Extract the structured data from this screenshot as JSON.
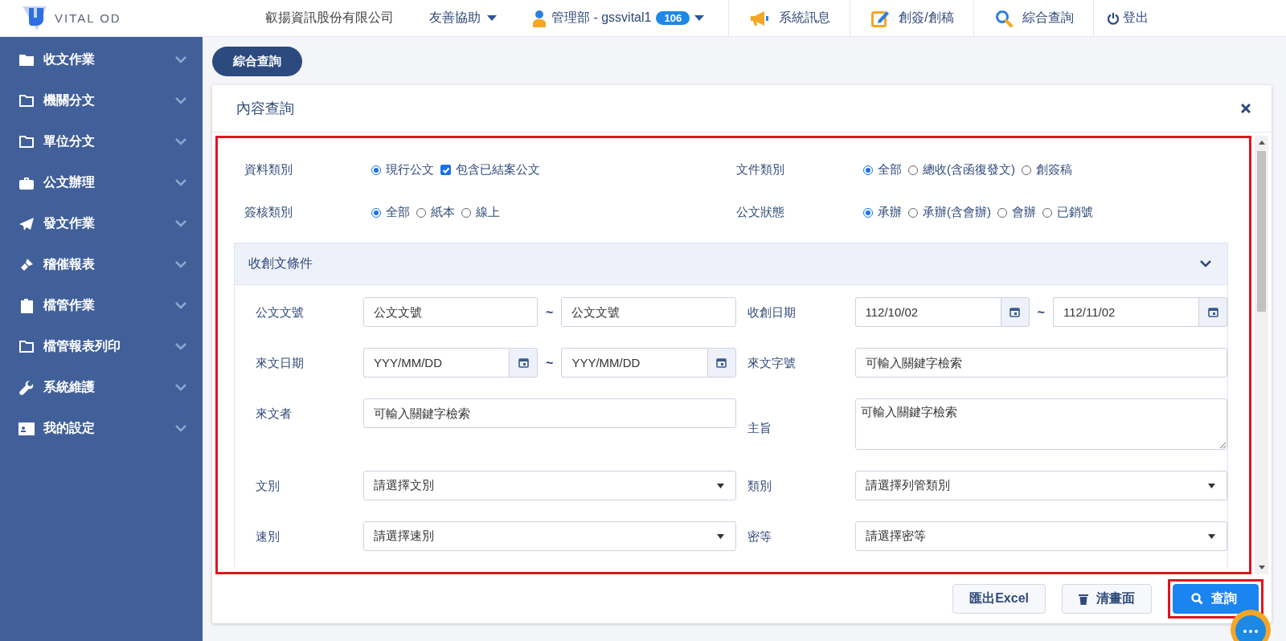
{
  "header": {
    "logo_text": "VITAL OD",
    "company": "叡揚資訊股份有限公司",
    "help": "友善協助",
    "user": "管理部 - gssvital1",
    "badge": "106",
    "nav": [
      {
        "kind": "megaphone",
        "label": "系統訊息"
      },
      {
        "kind": "edit",
        "label": "創簽/創稿"
      },
      {
        "kind": "search",
        "label": "綜合查詢"
      },
      {
        "kind": "power",
        "label": "登出"
      }
    ]
  },
  "sidebar": {
    "items": [
      {
        "kind": "folder-solid",
        "label": "收文作業"
      },
      {
        "kind": "folder",
        "label": "機關分文"
      },
      {
        "kind": "folder",
        "label": "單位分文"
      },
      {
        "kind": "briefcase",
        "label": "公文辦理"
      },
      {
        "kind": "plane",
        "label": "發文作業"
      },
      {
        "kind": "bullhorn",
        "label": "稽催報表"
      },
      {
        "kind": "clipboard",
        "label": "檔管作業"
      },
      {
        "kind": "folder",
        "label": "檔管報表列印"
      },
      {
        "kind": "wrench",
        "label": "系統維護"
      },
      {
        "kind": "card",
        "label": "我的設定"
      }
    ]
  },
  "page_button": "綜合查詢",
  "panel": {
    "title": "內容查詢",
    "option_groups": [
      {
        "label": "資料類別",
        "options": [
          {
            "kind": "radio",
            "label": "現行公文",
            "selected": true
          },
          {
            "kind": "checkbox",
            "label": "包含已結案公文",
            "checked": true
          }
        ]
      },
      {
        "label": "文件類別",
        "options": [
          {
            "kind": "radio",
            "label": "全部",
            "selected": true
          },
          {
            "kind": "radio",
            "label": "總收(含函復發文)",
            "selected": false
          },
          {
            "kind": "radio",
            "label": "創簽稿",
            "selected": false
          }
        ]
      },
      {
        "label": "簽核類別",
        "options": [
          {
            "kind": "radio",
            "label": "全部",
            "selected": true
          },
          {
            "kind": "radio",
            "label": "紙本",
            "selected": false
          },
          {
            "kind": "radio",
            "label": "線上",
            "selected": false
          }
        ]
      },
      {
        "label": "公文狀態",
        "options": [
          {
            "kind": "radio",
            "label": "承辦",
            "selected": true
          },
          {
            "kind": "radio",
            "label": "承辦(含會辦)",
            "selected": false
          },
          {
            "kind": "radio",
            "label": "會辦",
            "selected": false
          },
          {
            "kind": "radio",
            "label": "已銷號",
            "selected": false
          }
        ]
      }
    ],
    "section": {
      "title": "收創文條件",
      "expanded": true,
      "fields": [
        {
          "label": "公文文號",
          "kind": "range",
          "from": {
            "placeholder": "公文文號"
          },
          "separator": "~",
          "to": {
            "placeholder": "公文文號"
          }
        },
        {
          "label": "收創日期",
          "kind": "date_range",
          "from": {
            "value": "112/10/02"
          },
          "separator": "~",
          "to": {
            "value": "112/11/02"
          }
        },
        {
          "label": "來文日期",
          "kind": "date_range",
          "from": {
            "placeholder": "YYY/MM/DD"
          },
          "separator": "~",
          "to": {
            "placeholder": "YYY/MM/DD"
          }
        },
        {
          "label": "來文字號",
          "kind": "text",
          "placeholder": "可輸入關鍵字檢索"
        },
        {
          "label": "來文者",
          "kind": "text",
          "placeholder": "可輸入關鍵字檢索"
        },
        {
          "label": "主旨",
          "kind": "textarea",
          "placeholder": "可輸入關鍵字檢索"
        },
        {
          "label": "文別",
          "kind": "select",
          "placeholder": "請選擇文別"
        },
        {
          "label": "類別",
          "kind": "select",
          "placeholder": "請選擇列管類別"
        },
        {
          "label": "速別",
          "kind": "select",
          "placeholder": "請選擇速別"
        },
        {
          "label": "密等",
          "kind": "select",
          "placeholder": "請選擇密等"
        }
      ]
    },
    "buttons": [
      {
        "kind": "plain",
        "label": "匯出Excel"
      },
      {
        "kind": "trash",
        "label": "清畫面"
      },
      {
        "kind": "primary",
        "label": "查詢"
      }
    ]
  }
}
